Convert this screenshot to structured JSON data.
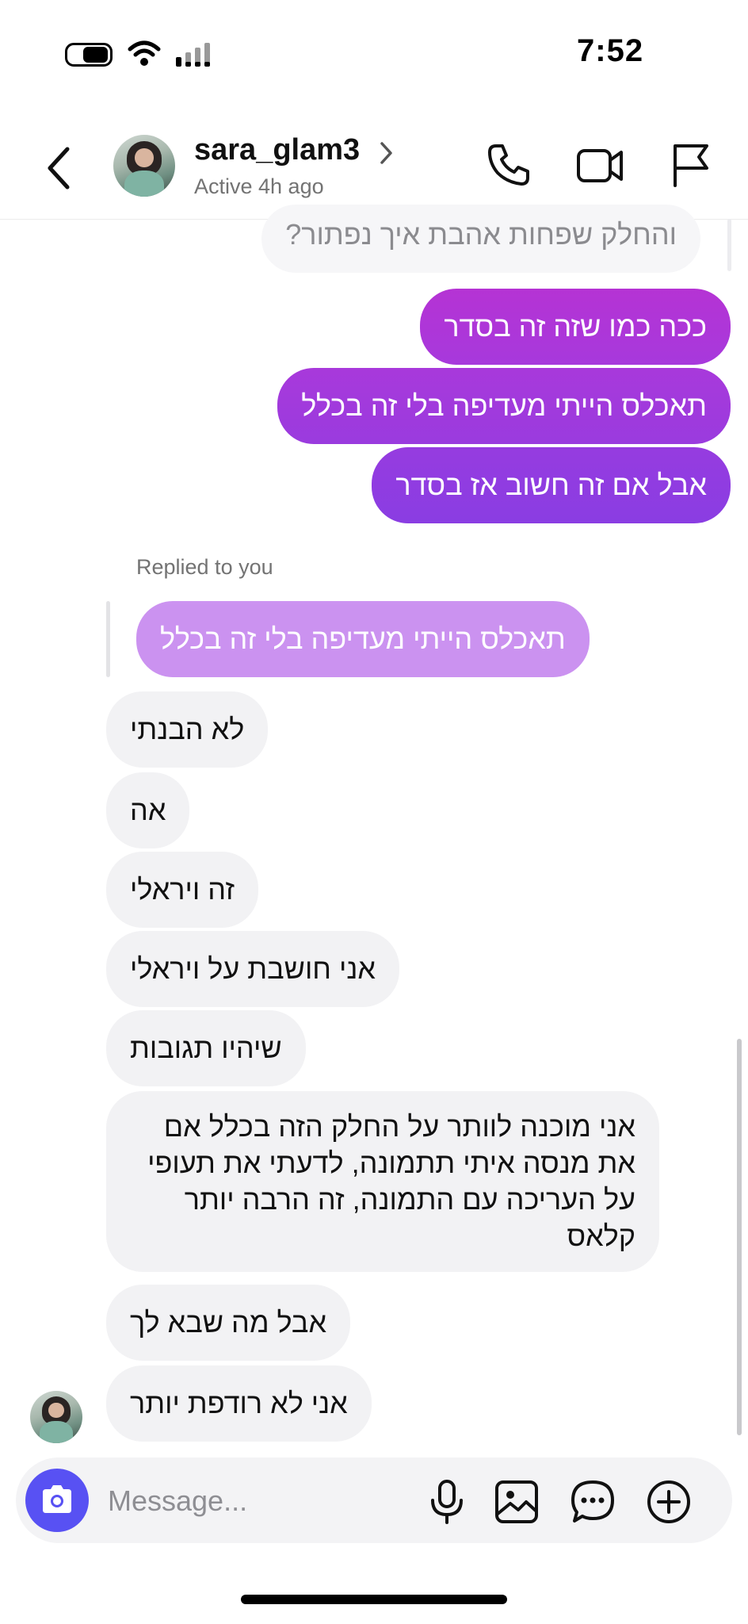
{
  "status_bar": {
    "time": "7:52"
  },
  "header": {
    "username": "sara_glam3",
    "active_status": "Active 4h ago"
  },
  "messages": [
    {
      "direction": "incoming",
      "text": "והחלק שפחות אהבת איך נפתור?"
    },
    {
      "direction": "outgoing",
      "text": "ככה כמו שזה זה בסדר"
    },
    {
      "direction": "outgoing",
      "text": "תאכלס הייתי מעדיפה בלי זה בכלל"
    },
    {
      "direction": "outgoing",
      "text": "אבל אם זה חשוב אז בסדר"
    },
    {
      "direction": "incoming",
      "text": "לא הבנתי"
    },
    {
      "direction": "incoming",
      "text": "אה"
    },
    {
      "direction": "incoming",
      "text": "זה ויראלי"
    },
    {
      "direction": "incoming",
      "text": "אני חושבת על ויראלי"
    },
    {
      "direction": "incoming",
      "text": "שיהיו תגובות"
    },
    {
      "direction": "incoming",
      "text": "אני מוכנה לוותר על החלק הזה בכלל אם את מנסה איתי תתמונה, לדעתי את תעופי על העריכה עם התמונה, זה הרבה יותר קלאס"
    },
    {
      "direction": "incoming",
      "text": "אבל מה שבא לך"
    },
    {
      "direction": "incoming",
      "text": "אני לא רודפת יותר"
    }
  ],
  "reply": {
    "label": "Replied to you",
    "quoted_text": "תאכלס הייתי מעדיפה בלי זה בכלל"
  },
  "composer": {
    "placeholder": "Message..."
  },
  "colors": {
    "outgoing_top": "#b335d6",
    "outgoing_bottom": "#8a3de2",
    "incoming_bg": "#f2f2f4",
    "camera_button": "#5851f3"
  },
  "icons": [
    "back-arrow-icon",
    "chevron-right-icon",
    "phone-icon",
    "video-camera-icon",
    "flag-icon",
    "camera-icon",
    "microphone-icon",
    "gallery-icon",
    "sticker-chat-icon",
    "plus-circle-icon"
  ]
}
